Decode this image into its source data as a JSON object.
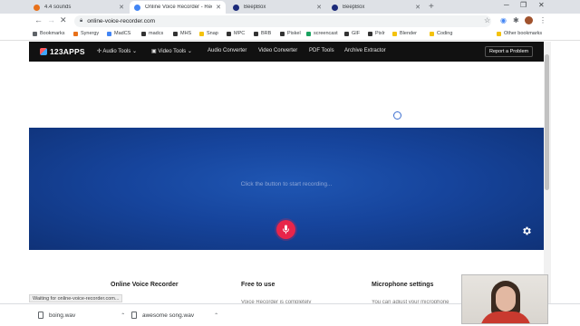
{
  "browser": {
    "tabs": [
      {
        "title": "4.4 sounds",
        "favicon_color": "#e8711a",
        "active": false
      },
      {
        "title": "Online Voice Recorder - Record V",
        "favicon_color": "#4285f4",
        "active": true
      },
      {
        "title": "BeepBox",
        "favicon_color": "#1b2a7a",
        "active": false
      },
      {
        "title": "BeepBox",
        "favicon_color": "#1b2a7a",
        "active": false
      }
    ],
    "new_tab_label": "+",
    "url": "online-voice-recorder.com",
    "bookmarks": [
      {
        "label": "Bookmarks",
        "color": "#5f6368"
      },
      {
        "label": "Synergy",
        "color": "#e8711a"
      },
      {
        "label": "MadCS",
        "color": "#4285f4"
      },
      {
        "label": "madcs",
        "color": "#333333"
      },
      {
        "label": "MHS",
        "color": "#333333"
      },
      {
        "label": "Snap",
        "color": "#f4c20d"
      },
      {
        "label": "MPC",
        "color": "#333333"
      },
      {
        "label": "BRB",
        "color": "#333333"
      },
      {
        "label": "Piskel",
        "color": "#333333"
      },
      {
        "label": "screencast",
        "color": "#1aa260"
      },
      {
        "label": "GIF",
        "color": "#333333"
      },
      {
        "label": "Pixlr",
        "color": "#333333"
      },
      {
        "label": "Blender",
        "color": "#f4c20d"
      },
      {
        "label": "Coding",
        "color": "#f4c20d"
      },
      {
        "label": "Other bookmarks",
        "color": "#f4c20d"
      }
    ]
  },
  "site": {
    "logo_text": "123APPS",
    "nav": [
      "Audio Tools",
      "Video Tools",
      "Audio Converter",
      "Video Converter",
      "PDF Tools",
      "Archive Extractor"
    ],
    "report_label": "Report a Problem"
  },
  "recorder": {
    "hint": "Click the button to start recording...",
    "mic_color": "#e8254a",
    "bg_color": "#16449c"
  },
  "info": [
    {
      "title": "Online Voice Recorder",
      "text": ""
    },
    {
      "title": "Free to use",
      "text": "Voice Recorder is completely"
    },
    {
      "title": "Microphone settings",
      "text": "You can adjust your microphone"
    }
  ],
  "status_text": "Waiting for online-voice-recorder.com...",
  "downloads": [
    {
      "filename": "boing.wav"
    },
    {
      "filename": "awesome song.wav"
    }
  ]
}
